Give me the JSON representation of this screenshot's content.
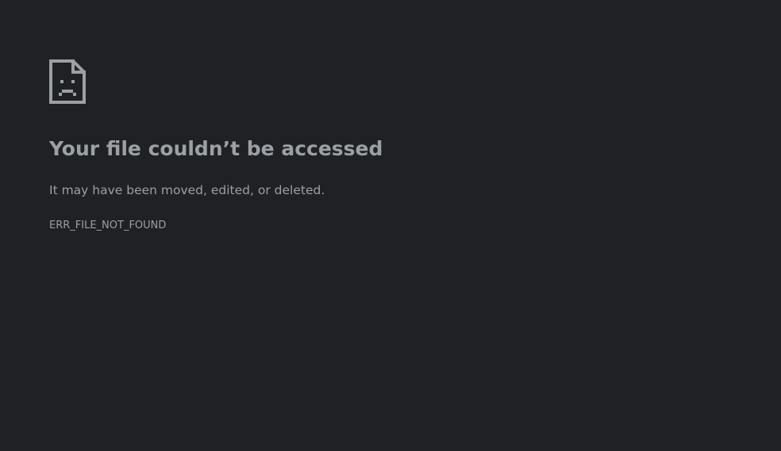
{
  "page": {
    "background_color": "#202124",
    "text_color": "#9aa0a6",
    "icon": "sad-file-icon",
    "title": "Your file couldn’t be accessed",
    "message": "It may have been moved, edited, or deleted.",
    "error_code": "ERR_FILE_NOT_FOUND"
  }
}
